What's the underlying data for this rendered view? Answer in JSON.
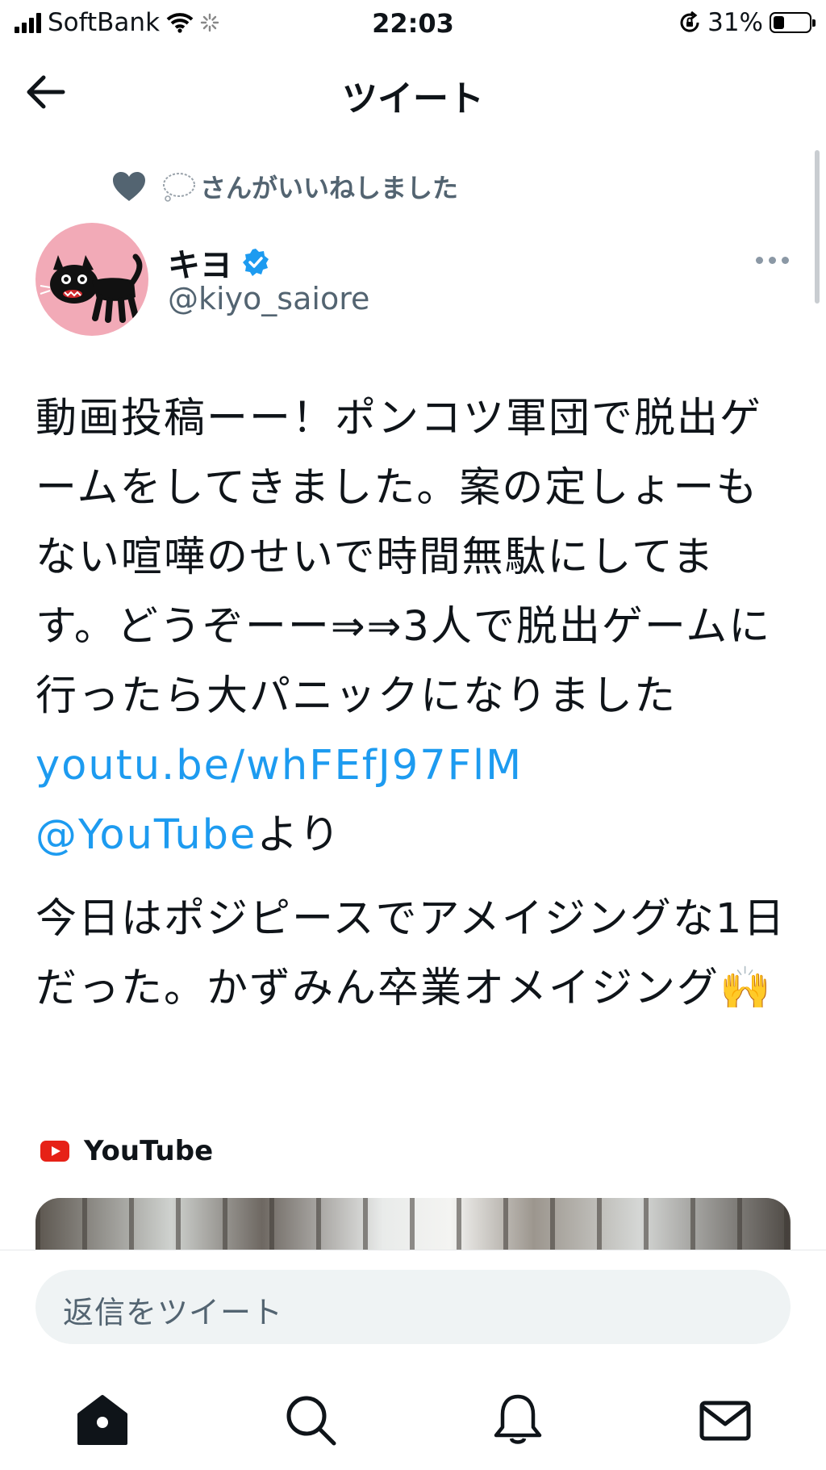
{
  "status_bar": {
    "carrier": "SoftBank",
    "time": "22:03",
    "battery_percent": "31%",
    "battery_level": 0.31
  },
  "header": {
    "title": "ツイート"
  },
  "tweet": {
    "social_context": "さんがいいねしました",
    "author_name": "キヨ",
    "author_handle": "@kiyo_saiore",
    "verified": true,
    "text_part1": "動画投稿ーー！ポンコツ軍団で脱出ゲームをしてきました。案の定しょーもない喧嘩のせいで時間無駄にしてます。どうぞーー⇒⇒3人で脱出ゲームに行ったら大パニックになりました ",
    "link_url": "youtu.be/whFEfJ97FlM",
    "mention": "@YouTube",
    "mention_suffix": "より",
    "text_part2": "今日はポジピースでアメイジングな1日だった。かずみん卒業オメイジング",
    "emoji": "🙌",
    "card_source": "YouTube"
  },
  "reply": {
    "placeholder": "返信をツイート"
  },
  "tabbar": {
    "items": [
      "home-icon",
      "search-icon",
      "bell-icon",
      "mail-icon"
    ]
  },
  "colors": {
    "link": "#1d9bf0",
    "secondary_text": "#536471",
    "youtube_red": "#e62117",
    "verified_blue": "#1d9bf0"
  }
}
